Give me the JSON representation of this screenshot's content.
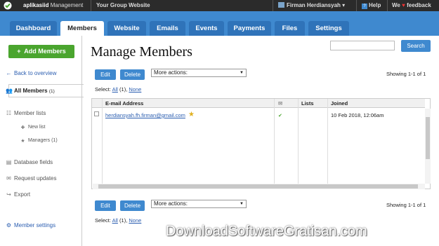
{
  "topbar": {
    "logo": "aplikasiid-logo",
    "app_name_bold": "aplikasiid",
    "app_name_rest": "Management",
    "group_website": "Your Group Website",
    "user_name": "Firman Herdiansyah",
    "help": "Help",
    "feedback_pre": "We",
    "feedback_heart": "♥",
    "feedback_post": "feedback"
  },
  "nav": {
    "tabs": [
      "Dashboard",
      "Members",
      "Website",
      "Emails",
      "Events",
      "Payments",
      "Files",
      "Settings"
    ],
    "active": "Members"
  },
  "sidebar": {
    "add_members": "Add Members",
    "back": "Back to overview",
    "all_members": "All Members",
    "all_members_count": "(1)",
    "member_lists": "Member lists",
    "new_list": "New list",
    "managers": "Managers",
    "managers_count": "(1)",
    "database_fields": "Database fields",
    "request_updates": "Request updates",
    "export": "Export",
    "member_settings": "Member settings"
  },
  "main": {
    "title": "Manage Members",
    "search_value": "",
    "search_button": "Search",
    "edit": "Edit",
    "delete": "Delete",
    "more_actions": "More actions:",
    "showing": "Showing 1-1 of 1",
    "select_label": "Select:",
    "select_all": "All",
    "select_all_count": "(1),",
    "select_none": "None",
    "columns": [
      "E-mail Address",
      "",
      "Lists",
      "Joined"
    ],
    "rows": [
      {
        "email": "herdiansyah.fh.firman@gmail.com",
        "verified": "✔",
        "lists": "",
        "joined": "10 Feb 2018, 12:06am"
      }
    ]
  },
  "watermark": "DownloadSoftwareGratisan.com",
  "colors": {
    "topbar": "#2b2b2b",
    "nav": "#3f89cf",
    "tab": "#2f73b9",
    "button": "#3f89cf",
    "add": "#4aa52e",
    "link": "#2a5db0"
  }
}
